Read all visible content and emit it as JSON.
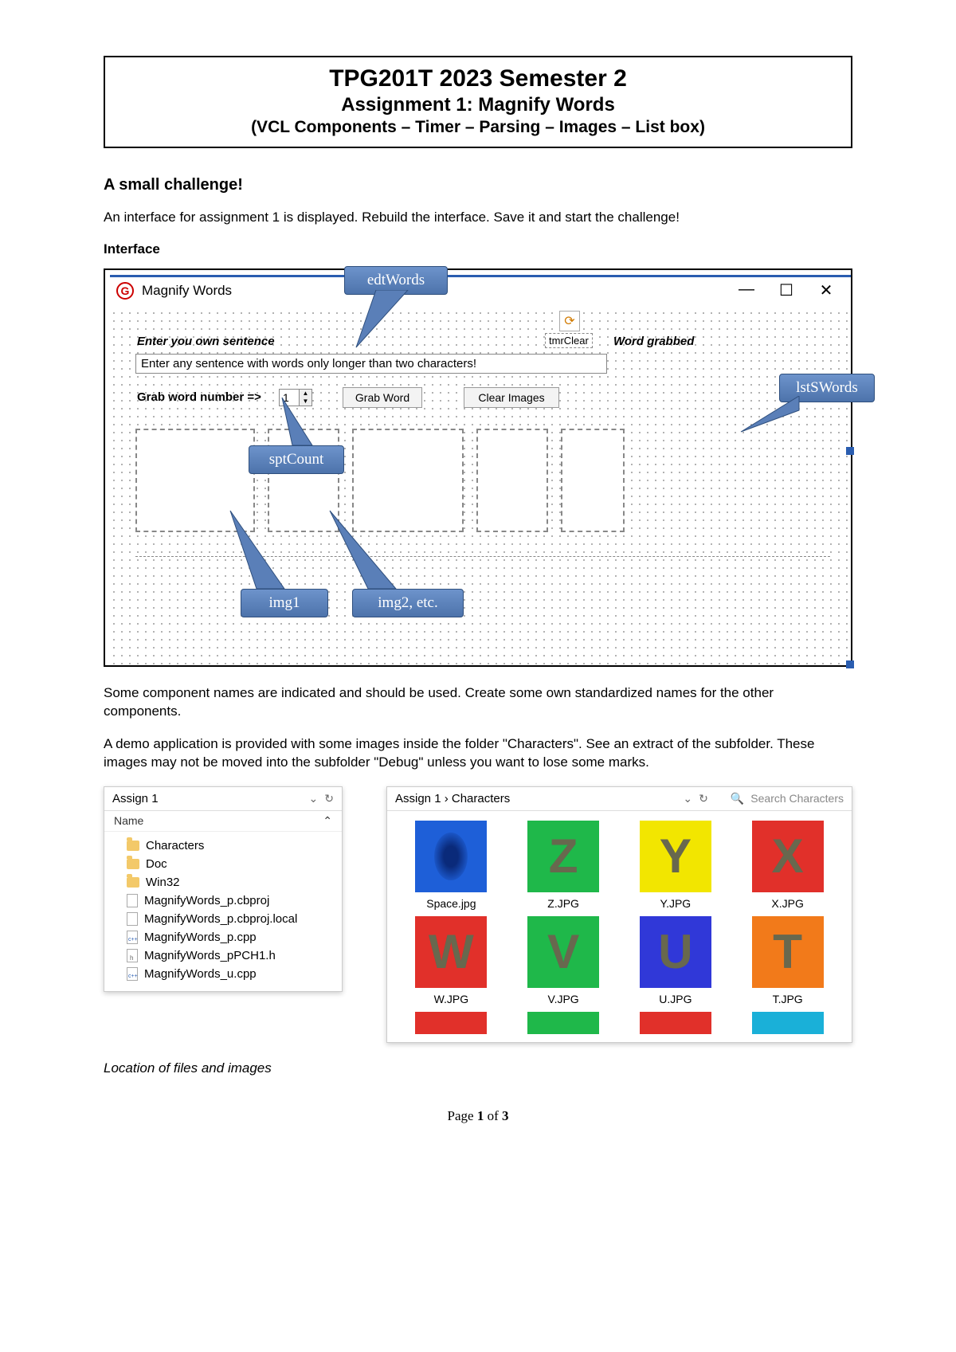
{
  "title": {
    "main": "TPG201T 2023 Semester 2",
    "sub": "Assignment 1: Magnify Words",
    "sub2": "(VCL Components – Timer – Parsing – Images – List box)"
  },
  "section_heading": "A small challenge!",
  "intro": "An interface for assignment 1 is displayed. Rebuild the interface. Save it and start the challenge!",
  "interface_heading": "Interface",
  "window": {
    "title": "Magnify Words",
    "lbl_sentence": "Enter you own sentence",
    "edt_placeholder": "Enter any sentence with words only longer than two characters!",
    "lbl_grab": "Grab word number =>",
    "spin_value": "1",
    "btn_grab": "Grab Word",
    "btn_clear": "Clear Images",
    "timer_label": "tmrClear",
    "lbl_grabbed": "Word grabbed"
  },
  "callouts": {
    "edtWords": "edtWords",
    "lstSWords": "lstSWords",
    "sptCount": "sptCount",
    "img1": "img1",
    "img2": "img2, etc."
  },
  "para2": "Some component names are indicated and should be used. Create some own standardized names for the other components.",
  "para3": "A demo application is provided with some images inside the folder \"Characters\". See an extract of the subfolder. These images may not be moved into the subfolder \"Debug\" unless you want to lose some marks.",
  "explorer_left": {
    "crumb": "Assign 1",
    "col": "Name",
    "items": [
      {
        "type": "folder",
        "name": "Characters"
      },
      {
        "type": "folder",
        "name": "Doc"
      },
      {
        "type": "folder",
        "name": "Win32"
      },
      {
        "type": "file",
        "name": "MagnifyWords_p.cbproj"
      },
      {
        "type": "file",
        "name": "MagnifyWords_p.cbproj.local"
      },
      {
        "type": "cpp",
        "name": "MagnifyWords_p.cpp"
      },
      {
        "type": "h",
        "name": "MagnifyWords_pPCH1.h"
      },
      {
        "type": "cpp",
        "name": "MagnifyWords_u.cpp"
      }
    ]
  },
  "explorer_right": {
    "crumb": "Assign 1  ›  Characters",
    "search": "Search Characters",
    "thumbs": [
      {
        "label": "Space.jpg",
        "bg": "#1e5fd8",
        "glyph": " "
      },
      {
        "label": "Z.JPG",
        "bg": "#1fb84a",
        "glyph": "Z"
      },
      {
        "label": "Y.JPG",
        "bg": "#f2e600",
        "glyph": "Y"
      },
      {
        "label": "X.JPG",
        "bg": "#e1302a",
        "glyph": "X"
      },
      {
        "label": "W.JPG",
        "bg": "#e1302a",
        "glyph": "W"
      },
      {
        "label": "V.JPG",
        "bg": "#1fb84a",
        "glyph": "V"
      },
      {
        "label": "U.JPG",
        "bg": "#3038d8",
        "glyph": "U"
      },
      {
        "label": "T.JPG",
        "bg": "#f27a1a",
        "glyph": "T"
      }
    ]
  },
  "caption": "Location of files and images",
  "page": {
    "pre": "Page ",
    "num": "1",
    "mid": " of ",
    "total": "3"
  }
}
